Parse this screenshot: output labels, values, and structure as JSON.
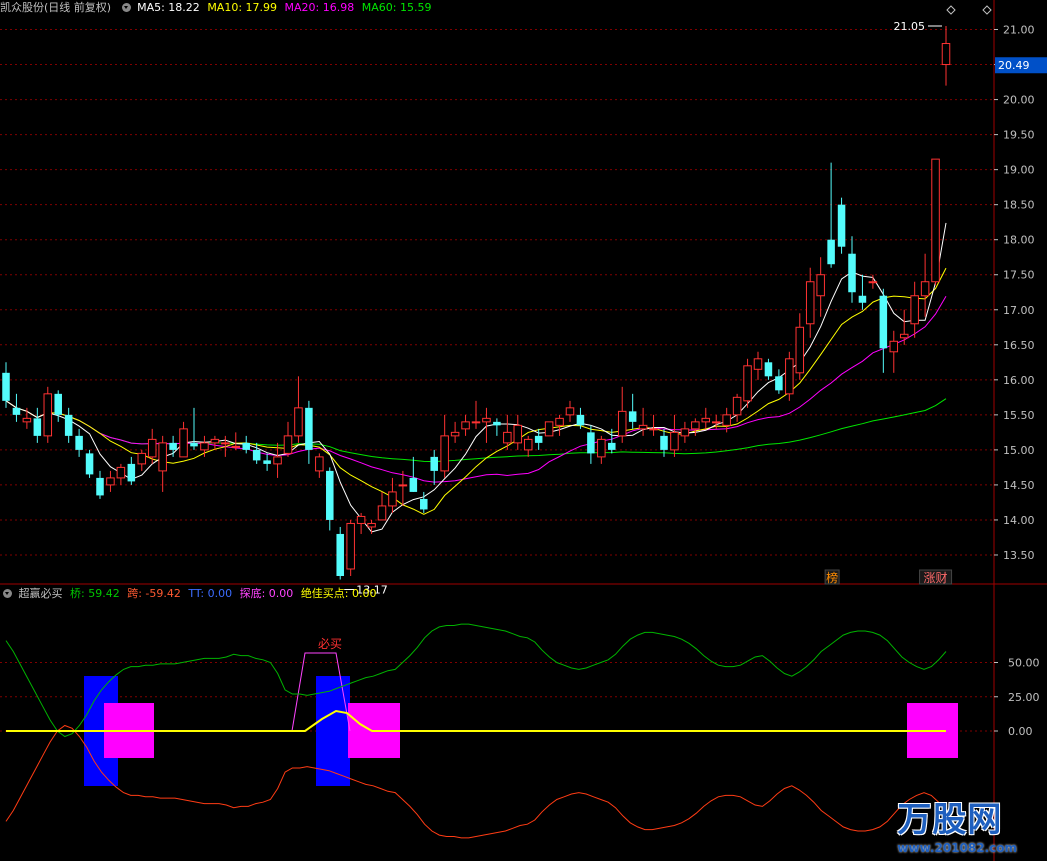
{
  "header": {
    "stock_name": "凯众股份(日线 前复权)",
    "ma5": "MA5: 18.22",
    "ma10": "MA10: 17.99",
    "ma20": "MA20: 16.98",
    "ma60": "MA60: 15.59"
  },
  "sub_header": {
    "indicator_name": "超赢必买",
    "qiao": "桥: 59.42",
    "kua": "跨: -59.42",
    "tt": "TT: 0.00",
    "tandi": "探底: 0.00",
    "jiajia": "绝佳买点: 0.00"
  },
  "colors": {
    "up": "#ff3232",
    "down": "#54fcfc",
    "ma5": "#ffffff",
    "ma10": "#ffff00",
    "ma20": "#ff00ff",
    "ma60": "#00e600",
    "grid": "#800000",
    "axis": "#c0c0c0",
    "price_tag_bg": "#0050c8"
  },
  "watermark": {
    "brand": "万股网",
    "site": "www.201082.com"
  },
  "chart_data": [
    {
      "type": "candlestick",
      "title": "凯众股份(日线 前复权)",
      "ylim": [
        13.1,
        21.25
      ],
      "y_ticks": [
        "13.50",
        "14.00",
        "14.50",
        "15.00",
        "15.50",
        "16.00",
        "16.50",
        "17.00",
        "17.50",
        "18.00",
        "18.50",
        "19.00",
        "19.50",
        "20.00",
        "20.50",
        "21.00"
      ],
      "last_price": "20.49",
      "annotations": {
        "high": "21.05",
        "low": "13.17"
      },
      "markers": [
        "榜",
        "涨财"
      ],
      "candles": [
        [
          16.1,
          16.25,
          15.6,
          15.7
        ],
        [
          15.6,
          15.8,
          15.4,
          15.5
        ],
        [
          15.4,
          15.6,
          15.3,
          15.45
        ],
        [
          15.45,
          15.6,
          15.1,
          15.2
        ],
        [
          15.2,
          15.9,
          15.1,
          15.8
        ],
        [
          15.8,
          15.85,
          15.4,
          15.5
        ],
        [
          15.5,
          15.6,
          15.1,
          15.2
        ],
        [
          15.2,
          15.3,
          14.9,
          15.0
        ],
        [
          14.95,
          15.0,
          14.6,
          14.65
        ],
        [
          14.6,
          14.7,
          14.3,
          14.35
        ],
        [
          14.5,
          14.7,
          14.4,
          14.6
        ],
        [
          14.6,
          14.8,
          14.5,
          14.75
        ],
        [
          14.8,
          14.9,
          14.5,
          14.55
        ],
        [
          14.8,
          15.0,
          14.7,
          14.95
        ],
        [
          14.9,
          15.3,
          14.8,
          15.15
        ],
        [
          14.7,
          15.2,
          14.4,
          15.1
        ],
        [
          15.1,
          15.2,
          14.9,
          15.0
        ],
        [
          14.9,
          15.4,
          14.9,
          15.3
        ],
        [
          15.1,
          15.6,
          15.0,
          15.05
        ],
        [
          15.0,
          15.2,
          14.9,
          15.1
        ],
        [
          15.1,
          15.2,
          15.0,
          15.15
        ],
        [
          15.1,
          15.2,
          14.9,
          15.1
        ],
        [
          15.05,
          15.25,
          15.0,
          15.05
        ],
        [
          15.1,
          15.2,
          14.95,
          15.0
        ],
        [
          15.0,
          15.1,
          14.8,
          14.85
        ],
        [
          14.85,
          14.95,
          14.7,
          14.8
        ],
        [
          14.8,
          15.1,
          14.6,
          14.9
        ],
        [
          14.95,
          15.4,
          14.9,
          15.2
        ],
        [
          15.2,
          16.05,
          15.1,
          15.6
        ],
        [
          15.6,
          15.7,
          14.8,
          15.0
        ],
        [
          14.7,
          14.95,
          14.6,
          14.9
        ],
        [
          14.7,
          14.75,
          13.85,
          14.0
        ],
        [
          13.8,
          13.9,
          13.15,
          13.2
        ],
        [
          13.3,
          14.0,
          13.2,
          13.95
        ],
        [
          13.95,
          14.1,
          13.8,
          14.05
        ],
        [
          13.9,
          14.0,
          13.8,
          13.95
        ],
        [
          14.0,
          14.4,
          14.0,
          14.2
        ],
        [
          14.2,
          14.6,
          14.1,
          14.4
        ],
        [
          14.5,
          14.7,
          14.2,
          14.5
        ],
        [
          14.6,
          14.9,
          14.4,
          14.4
        ],
        [
          14.3,
          14.4,
          14.1,
          14.15
        ],
        [
          14.9,
          15.0,
          14.5,
          14.7
        ],
        [
          14.7,
          15.5,
          14.6,
          15.2
        ],
        [
          15.2,
          15.4,
          15.1,
          15.25
        ],
        [
          15.3,
          15.5,
          15.2,
          15.4
        ],
        [
          15.4,
          15.7,
          15.3,
          15.4
        ],
        [
          15.4,
          15.6,
          15.1,
          15.45
        ],
        [
          15.4,
          15.45,
          15.2,
          15.35
        ],
        [
          15.1,
          15.5,
          15.0,
          15.25
        ],
        [
          15.1,
          15.5,
          15.0,
          15.35
        ],
        [
          15.0,
          15.2,
          14.9,
          15.15
        ],
        [
          15.2,
          15.3,
          15.0,
          15.1
        ],
        [
          15.2,
          15.4,
          15.2,
          15.4
        ],
        [
          15.35,
          15.5,
          15.2,
          15.45
        ],
        [
          15.5,
          15.7,
          15.4,
          15.6
        ],
        [
          15.5,
          15.6,
          15.3,
          15.35
        ],
        [
          15.25,
          15.35,
          14.8,
          14.95
        ],
        [
          14.9,
          15.2,
          14.8,
          15.15
        ],
        [
          15.1,
          15.3,
          14.95,
          15.0
        ],
        [
          15.2,
          15.9,
          15.1,
          15.55
        ],
        [
          15.55,
          15.8,
          15.3,
          15.4
        ],
        [
          15.3,
          15.6,
          15.2,
          15.35
        ],
        [
          15.3,
          15.5,
          15.2,
          15.3
        ],
        [
          15.2,
          15.3,
          14.9,
          15.0
        ],
        [
          15.0,
          15.5,
          14.9,
          15.25
        ],
        [
          15.2,
          15.4,
          15.1,
          15.3
        ],
        [
          15.3,
          15.45,
          15.2,
          15.4
        ],
        [
          15.4,
          15.6,
          15.3,
          15.45
        ],
        [
          15.4,
          15.5,
          15.3,
          15.4
        ],
        [
          15.35,
          15.6,
          15.25,
          15.5
        ],
        [
          15.5,
          15.8,
          15.4,
          15.75
        ],
        [
          15.7,
          16.3,
          15.6,
          16.2
        ],
        [
          16.15,
          16.4,
          16.0,
          16.3
        ],
        [
          16.25,
          16.3,
          16.0,
          16.05
        ],
        [
          16.05,
          16.15,
          15.8,
          15.85
        ],
        [
          15.8,
          16.4,
          15.7,
          16.3
        ],
        [
          16.1,
          16.95,
          16.0,
          16.75
        ],
        [
          16.8,
          17.6,
          16.6,
          17.4
        ],
        [
          17.2,
          17.75,
          16.9,
          17.5
        ],
        [
          18.0,
          19.1,
          17.6,
          17.65
        ],
        [
          18.5,
          18.6,
          17.8,
          17.9
        ],
        [
          17.8,
          18.05,
          17.1,
          17.25
        ],
        [
          17.2,
          17.5,
          17.0,
          17.1
        ],
        [
          17.4,
          17.5,
          17.3,
          17.4
        ],
        [
          17.2,
          17.3,
          16.1,
          16.45
        ],
        [
          16.4,
          16.7,
          16.1,
          16.55
        ],
        [
          16.6,
          17.0,
          16.5,
          16.65
        ],
        [
          16.8,
          17.4,
          16.6,
          17.2
        ],
        [
          17.2,
          17.8,
          16.9,
          17.4
        ],
        [
          17.4,
          19.15,
          17.35,
          19.15
        ],
        [
          20.5,
          21.05,
          20.2,
          20.8
        ]
      ]
    },
    {
      "type": "line",
      "title": "超赢必买",
      "ylim": [
        -100,
        100
      ],
      "y_ticks": [
        "50.00",
        "25.00",
        "0.00"
      ],
      "label": "必买",
      "series": [
        {
          "name": "桥",
          "values": [
            66,
            58,
            48,
            38,
            28,
            18,
            8,
            0,
            -4,
            -2,
            4,
            12,
            22,
            30,
            36,
            41,
            45,
            47,
            47,
            48,
            48,
            49,
            49,
            49,
            50,
            51,
            52,
            53,
            53,
            53,
            54,
            56,
            55,
            55,
            53,
            52,
            50,
            42,
            30,
            27,
            27,
            26,
            27,
            28,
            29,
            31,
            33,
            35,
            37,
            39,
            40,
            42,
            44,
            45,
            50,
            55,
            61,
            68,
            73,
            76,
            77,
            77,
            78,
            78,
            77,
            76,
            75,
            74,
            73,
            71,
            69,
            68,
            65,
            59,
            54,
            50,
            48,
            46,
            45,
            46,
            48,
            50,
            52,
            56,
            62,
            67,
            70,
            72,
            72,
            71,
            70,
            69,
            67,
            64,
            60,
            55,
            51,
            48,
            47,
            47,
            48,
            51,
            54,
            55,
            51,
            46,
            42,
            40,
            43,
            47,
            52,
            58,
            62,
            66,
            70,
            72,
            73,
            73,
            72,
            70,
            66,
            60,
            54,
            50,
            47,
            45,
            47,
            52,
            58
          ]
        },
        {
          "name": "跨",
          "values": [
            -66,
            -58,
            -48,
            -38,
            -28,
            -18,
            -8,
            0,
            4,
            2,
            -4,
            -12,
            -22,
            -30,
            -36,
            -41,
            -45,
            -47,
            -47,
            -48,
            -48,
            -49,
            -49,
            -49,
            -50,
            -51,
            -52,
            -53,
            -53,
            -53,
            -54,
            -56,
            -55,
            -55,
            -53,
            -52,
            -50,
            -42,
            -30,
            -27,
            -27,
            -26,
            -27,
            -28,
            -29,
            -31,
            -33,
            -35,
            -37,
            -39,
            -40,
            -42,
            -44,
            -45,
            -50,
            -55,
            -61,
            -68,
            -73,
            -76,
            -77,
            -77,
            -78,
            -78,
            -77,
            -76,
            -75,
            -74,
            -73,
            -71,
            -69,
            -68,
            -65,
            -59,
            -54,
            -50,
            -48,
            -46,
            -45,
            -46,
            -48,
            -50,
            -52,
            -56,
            -62,
            -67,
            -70,
            -72,
            -72,
            -71,
            -70,
            -69,
            -67,
            -64,
            -60,
            -55,
            -51,
            -48,
            -47,
            -47,
            -48,
            -51,
            -54,
            -55,
            -51,
            -46,
            -42,
            -40,
            -43,
            -47,
            -52,
            -58,
            -62,
            -66,
            -70,
            -72,
            -73,
            -73,
            -72,
            -70,
            -66,
            -60,
            -54,
            -50,
            -47,
            -45,
            -47,
            -52,
            -58
          ]
        }
      ]
    }
  ]
}
